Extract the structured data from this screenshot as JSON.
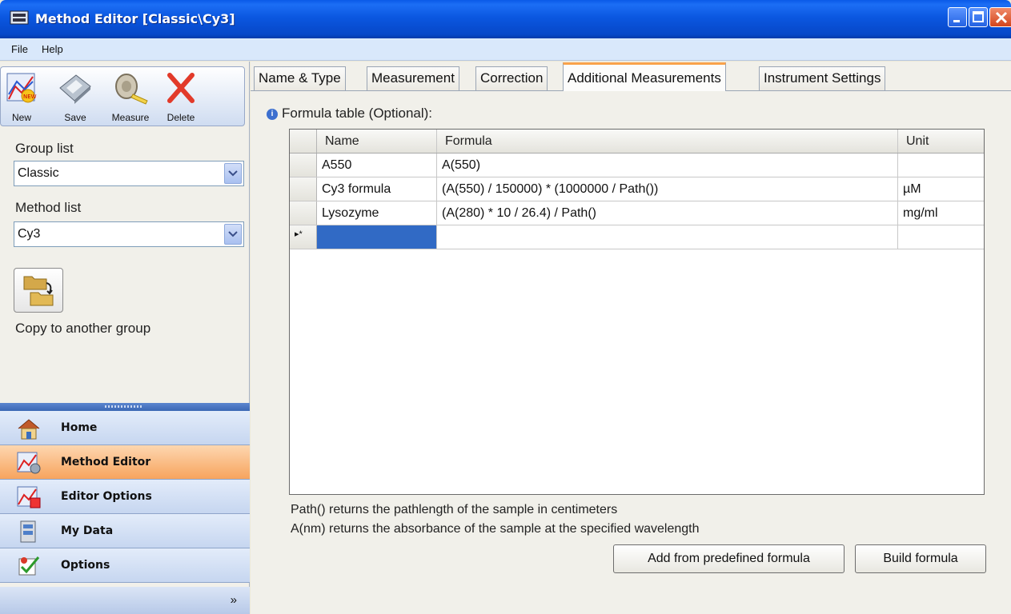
{
  "window": {
    "title": "Method Editor [Classic\\Cy3]"
  },
  "menu": [
    "File",
    "Help"
  ],
  "toolbar": {
    "new_label": "New",
    "save_label": "Save",
    "measure_label": "Measure",
    "delete_label": "Delete"
  },
  "group_list": {
    "label": "Group list",
    "value": "Classic"
  },
  "method_list": {
    "label": "Method list",
    "value": "Cy3"
  },
  "copy": {
    "label": "Copy to another group"
  },
  "nav": {
    "items": [
      {
        "label": "Home",
        "icon": "home-icon"
      },
      {
        "label": "Method Editor",
        "icon": "method-editor-icon",
        "active": true
      },
      {
        "label": "Editor Options",
        "icon": "editor-options-icon"
      },
      {
        "label": "My Data",
        "icon": "my-data-icon"
      },
      {
        "label": "Options",
        "icon": "options-icon"
      }
    ],
    "more": "»"
  },
  "tabs": [
    {
      "label": "Name & Type"
    },
    {
      "label": "Measurement"
    },
    {
      "label": "Correction"
    },
    {
      "label": "Additional Measurements",
      "active": true
    },
    {
      "label": "Instrument Settings"
    }
  ],
  "formula_table": {
    "caption": "Formula table (Optional):",
    "columns": [
      "Name",
      "Formula",
      "Unit"
    ],
    "rows": [
      {
        "name": "A550",
        "formula": "A(550)",
        "unit": ""
      },
      {
        "name": "Cy3 formula",
        "formula": "(A(550) / 150000) * (1000000 / Path())",
        "unit": "µM"
      },
      {
        "name": "Lysozyme",
        "formula": "(A(280) * 10 / 26.4) / Path()",
        "unit": "mg/ml"
      }
    ],
    "new_row_marker": "▸*"
  },
  "notes": [
    "Path() returns the pathlength of the sample in centimeters",
    "A(nm) returns the absorbance of the sample at the specified wavelength"
  ],
  "buttons": {
    "predefined": "Add from predefined formula",
    "build": "Build formula"
  },
  "colors": {
    "titlebar": "#0b57e0",
    "nav_active": "#f7a45e",
    "tab_active_accent": "#f9a24a",
    "row_selection": "#316ac5"
  }
}
